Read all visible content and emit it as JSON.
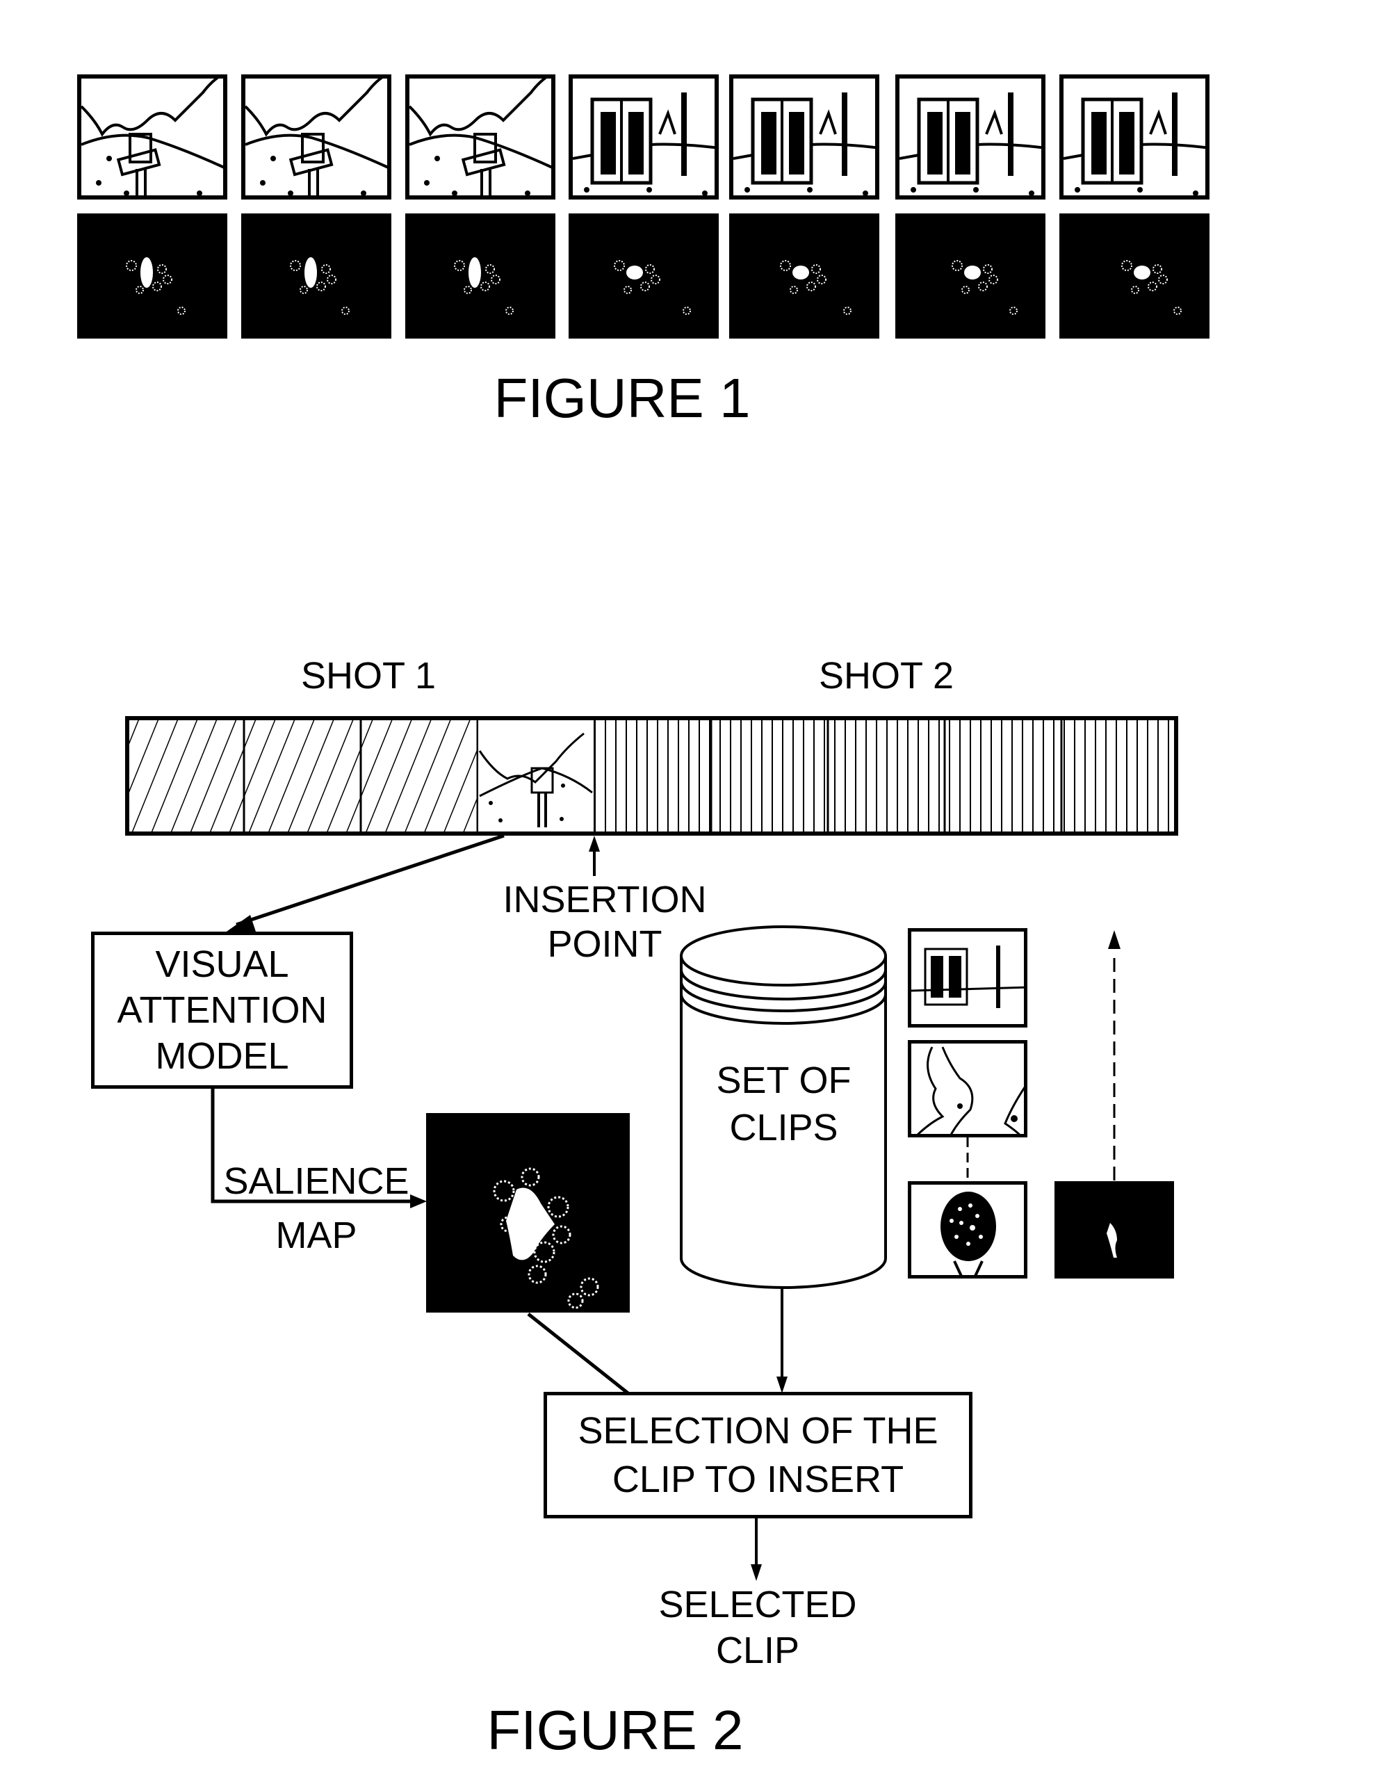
{
  "figure1": {
    "caption": "FIGURE 1",
    "frames": [
      {
        "scene": "golfer-walking",
        "mask": "salience-golfer"
      },
      {
        "scene": "golfer-walking",
        "mask": "salience-golfer"
      },
      {
        "scene": "golfer-walking",
        "mask": "salience-golfer"
      },
      {
        "scene": "scoreboard-tree",
        "mask": "salience-scoreboard"
      },
      {
        "scene": "scoreboard-tree",
        "mask": "salience-scoreboard"
      },
      {
        "scene": "scoreboard-tree",
        "mask": "salience-scoreboard"
      },
      {
        "scene": "scoreboard-tree",
        "mask": "salience-scoreboard"
      }
    ]
  },
  "figure2": {
    "caption": "FIGURE 2",
    "shot1_label": "SHOT 1",
    "shot2_label": "SHOT 2",
    "insertion_point": {
      "line1": "INSERTION",
      "line2": "POINT"
    },
    "visual_attention_model": {
      "line1": "VISUAL",
      "line2": "ATTENTION",
      "line3": "MODEL"
    },
    "salience_map": {
      "line1": "SALIENCE",
      "line2": "MAP"
    },
    "set_of_clips": {
      "line1": "SET OF",
      "line2": "CLIPS"
    },
    "selection_box": {
      "line1": "SELECTION OF THE",
      "line2": "CLIP TO INSERT"
    },
    "selected_clip": {
      "line1": "SELECTED",
      "line2": "CLIP"
    },
    "clip_thumbnails": [
      "scoreboard-clip",
      "map-clip",
      "golf-ball-clip"
    ]
  }
}
